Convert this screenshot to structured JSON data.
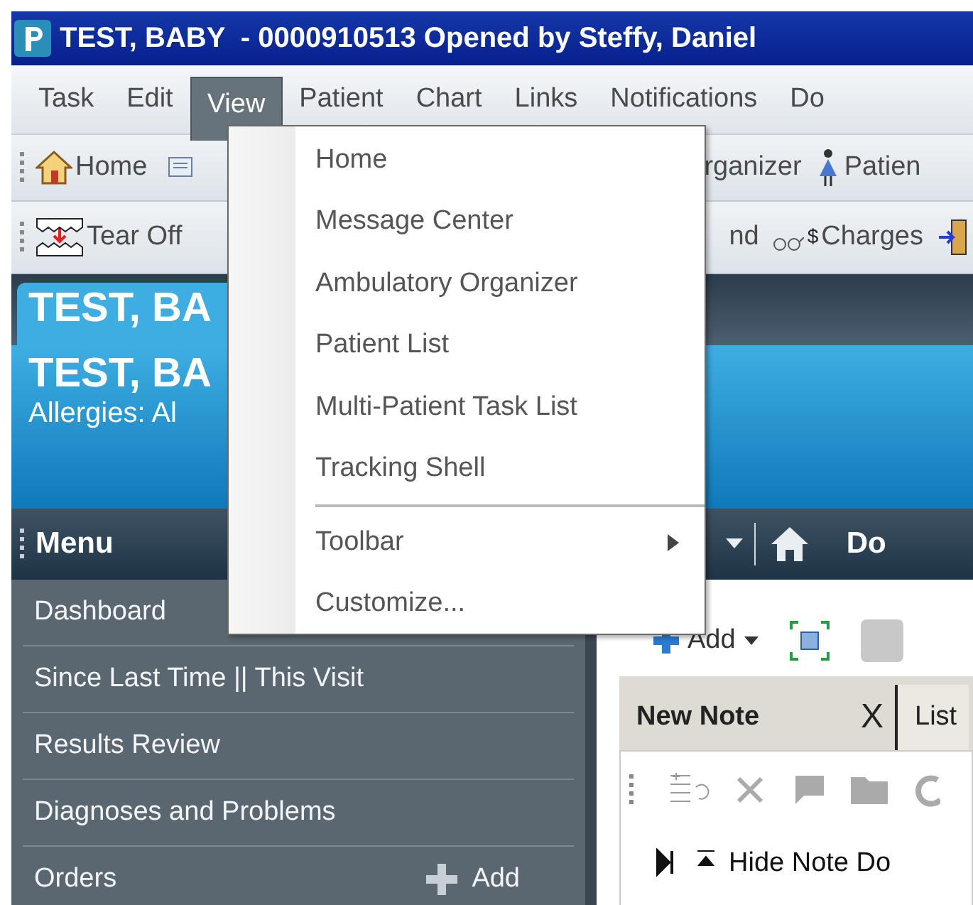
{
  "window": {
    "title": "TEST, BABY  - 0000910513 Opened by Steffy, Daniel"
  },
  "menu_bar": [
    {
      "label": "Task",
      "selected": false
    },
    {
      "label": "Edit",
      "selected": false
    },
    {
      "label": "View",
      "selected": true
    },
    {
      "label": "Patient",
      "selected": false
    },
    {
      "label": "Chart",
      "selected": false
    },
    {
      "label": "Links",
      "selected": false
    },
    {
      "label": "Notifications",
      "selected": false
    },
    {
      "label": "Do",
      "selected": false
    }
  ],
  "view_menu": [
    {
      "kind": "item",
      "label": "Home"
    },
    {
      "kind": "item",
      "label": "Message Center"
    },
    {
      "kind": "item",
      "label": "Ambulatory Organizer"
    },
    {
      "kind": "item",
      "label": "Patient List"
    },
    {
      "kind": "item",
      "label": "Multi-Patient Task List"
    },
    {
      "kind": "item",
      "label": "Tracking Shell"
    },
    {
      "kind": "separator"
    },
    {
      "kind": "submenu",
      "label": "Toolbar"
    },
    {
      "kind": "item",
      "label": "Customize..."
    }
  ],
  "toolbar_1": {
    "home": "Home",
    "organizer": "rganizer",
    "patient": "Patien"
  },
  "toolbar_2": {
    "tear_off": "Tear Off",
    "item_2": "nd",
    "charges_symbol": "$",
    "charges": "Charges"
  },
  "patient_banner": {
    "tab": "TEST, BA",
    "name": "TEST, BA",
    "allergies": "Allergies: Al"
  },
  "sidebar": {
    "header": "Menu",
    "items": [
      {
        "label": "Dashboard"
      },
      {
        "label": "Since Last Time || This Visit"
      },
      {
        "label": "Results Review"
      },
      {
        "label": "Diagnoses and Problems"
      },
      {
        "label": "Orders",
        "action": "Add"
      }
    ]
  },
  "nav_bar": {
    "page": "Do"
  },
  "content": {
    "add_button": "Add",
    "tabs": [
      {
        "label": "New Note",
        "selected": true,
        "close": "X"
      },
      {
        "label": "List",
        "selected": false
      }
    ],
    "note_action": "Hide Note Do"
  }
}
